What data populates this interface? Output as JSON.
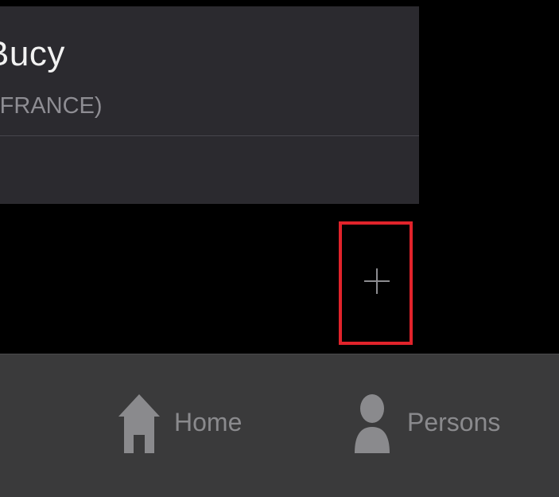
{
  "card": {
    "title": "Bucy",
    "subtitle": "(FRANCE)"
  },
  "actions": {
    "add_button_icon": "plus-icon"
  },
  "tabbar": {
    "items": [
      {
        "label": "Home",
        "icon": "home-icon"
      },
      {
        "label": "Persons",
        "icon": "person-icon"
      }
    ]
  },
  "colors": {
    "card_bg": "#2b2a2f",
    "tabbar_bg": "#3a3a3b",
    "highlight": "#e1232b",
    "text_primary": "#f2f2f2",
    "text_secondary": "#8e8d93",
    "tab_text": "#8a8a8d"
  }
}
